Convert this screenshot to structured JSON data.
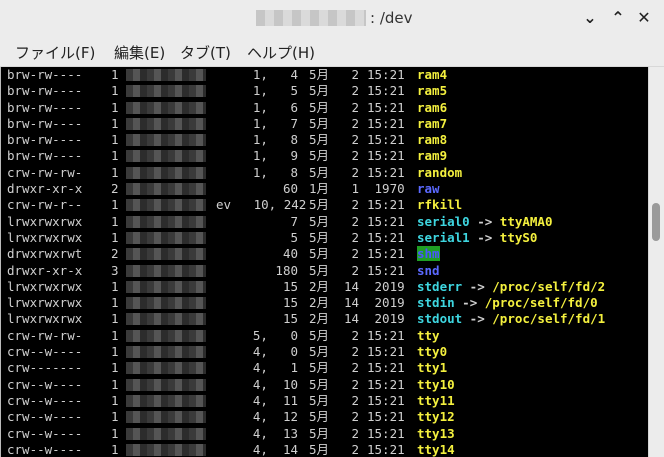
{
  "window": {
    "title": ": /dev"
  },
  "menu": [
    {
      "label": "ファイル(F)"
    },
    {
      "label": "編集(E)"
    },
    {
      "label": "タブ(T)"
    },
    {
      "label": "ヘルプ(H)"
    }
  ],
  "colors": {
    "yellow": "#f4f03e",
    "cyan": "#3ed6e0",
    "blue": "#5b69ff",
    "shm_bg": "#1f9e24",
    "shm_fg": "#4a55ff",
    "text": "#cfcfcf"
  },
  "rows": [
    {
      "perm": "brw-rw----",
      "links": "1",
      "majmin": "1,   4",
      "month": "5月",
      "day": "2",
      "time": "15:21",
      "name": "ram4",
      "type": "dev"
    },
    {
      "perm": "brw-rw----",
      "links": "1",
      "majmin": "1,   5",
      "month": "5月",
      "day": "2",
      "time": "15:21",
      "name": "ram5",
      "type": "dev"
    },
    {
      "perm": "brw-rw----",
      "links": "1",
      "majmin": "1,   6",
      "month": "5月",
      "day": "2",
      "time": "15:21",
      "name": "ram6",
      "type": "dev"
    },
    {
      "perm": "brw-rw----",
      "links": "1",
      "majmin": "1,   7",
      "month": "5月",
      "day": "2",
      "time": "15:21",
      "name": "ram7",
      "type": "dev"
    },
    {
      "perm": "brw-rw----",
      "links": "1",
      "majmin": "1,   8",
      "month": "5月",
      "day": "2",
      "time": "15:21",
      "name": "ram8",
      "type": "dev"
    },
    {
      "perm": "brw-rw----",
      "links": "1",
      "majmin": "1,   9",
      "month": "5月",
      "day": "2",
      "time": "15:21",
      "name": "ram9",
      "type": "dev"
    },
    {
      "perm": "crw-rw-rw-",
      "links": "1",
      "majmin": "1,   8",
      "month": "5月",
      "day": "2",
      "time": "15:21",
      "name": "random",
      "type": "dev"
    },
    {
      "perm": "drwxr-xr-x",
      "links": "2",
      "majmin": "60",
      "month": "1月",
      "day": "1",
      "time": " 1970",
      "name": "raw",
      "type": "dir"
    },
    {
      "perm": "crw-rw-r--",
      "links": "1",
      "majmin": "ev   10, 242",
      "month": "5月",
      "day": "2",
      "time": "15:21",
      "name": "rfkill",
      "type": "dev"
    },
    {
      "perm": "lrwxrwxrwx",
      "links": "1",
      "majmin": "7",
      "month": "5月",
      "day": "2",
      "time": "15:21",
      "name": "serial0",
      "target": "ttyAMA0",
      "type": "link",
      "target_type": "dev"
    },
    {
      "perm": "lrwxrwxrwx",
      "links": "1",
      "majmin": "5",
      "month": "5月",
      "day": "2",
      "time": "15:21",
      "name": "serial1",
      "target": "ttyS0",
      "type": "link",
      "target_type": "dev"
    },
    {
      "perm": "drwxrwxrwt",
      "links": "2",
      "majmin": "40",
      "month": "5月",
      "day": "2",
      "time": "15:21",
      "name": "shm",
      "type": "sticky"
    },
    {
      "perm": "drwxr-xr-x",
      "links": "3",
      "majmin": "180",
      "month": "5月",
      "day": "2",
      "time": "15:21",
      "name": "snd",
      "type": "dir"
    },
    {
      "perm": "lrwxrwxrwx",
      "links": "1",
      "majmin": "15",
      "month": "2月",
      "day": "14",
      "time": " 2019",
      "name": "stderr",
      "target": "/proc/self/fd/2",
      "type": "link",
      "target_type": "dev"
    },
    {
      "perm": "lrwxrwxrwx",
      "links": "1",
      "majmin": "15",
      "month": "2月",
      "day": "14",
      "time": " 2019",
      "name": "stdin",
      "target": "/proc/self/fd/0",
      "type": "link",
      "target_type": "dev"
    },
    {
      "perm": "lrwxrwxrwx",
      "links": "1",
      "majmin": "15",
      "month": "2月",
      "day": "14",
      "time": " 2019",
      "name": "stdout",
      "target": "/proc/self/fd/1",
      "type": "link",
      "target_type": "dev"
    },
    {
      "perm": "crw-rw-rw-",
      "links": "1",
      "majmin": "5,   0",
      "month": "5月",
      "day": "2",
      "time": "15:21",
      "name": "tty",
      "type": "dev"
    },
    {
      "perm": "crw--w----",
      "links": "1",
      "majmin": "4,   0",
      "month": "5月",
      "day": "2",
      "time": "15:21",
      "name": "tty0",
      "type": "dev"
    },
    {
      "perm": "crw-------",
      "links": "1",
      "majmin": "4,   1",
      "month": "5月",
      "day": "2",
      "time": "15:21",
      "name": "tty1",
      "type": "dev"
    },
    {
      "perm": "crw--w----",
      "links": "1",
      "majmin": "4,  10",
      "month": "5月",
      "day": "2",
      "time": "15:21",
      "name": "tty10",
      "type": "dev"
    },
    {
      "perm": "crw--w----",
      "links": "1",
      "majmin": "4,  11",
      "month": "5月",
      "day": "2",
      "time": "15:21",
      "name": "tty11",
      "type": "dev"
    },
    {
      "perm": "crw--w----",
      "links": "1",
      "majmin": "4,  12",
      "month": "5月",
      "day": "2",
      "time": "15:21",
      "name": "tty12",
      "type": "dev"
    },
    {
      "perm": "crw--w----",
      "links": "1",
      "majmin": "4,  13",
      "month": "5月",
      "day": "2",
      "time": "15:21",
      "name": "tty13",
      "type": "dev"
    },
    {
      "perm": "crw--w----",
      "links": "1",
      "majmin": "4,  14",
      "month": "5月",
      "day": "2",
      "time": "15:21",
      "name": "tty14",
      "type": "dev"
    }
  ]
}
